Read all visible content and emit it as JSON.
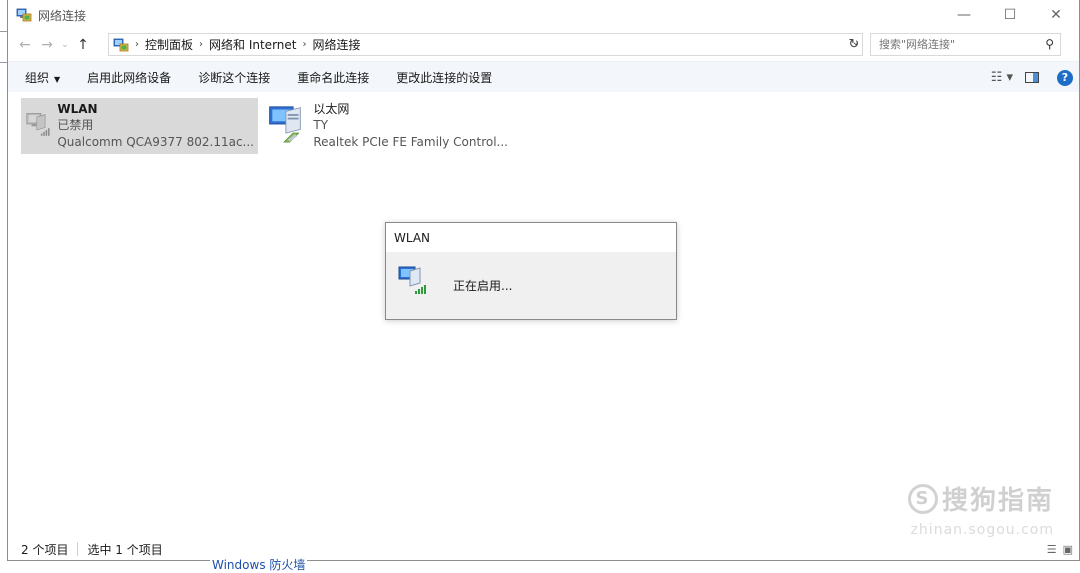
{
  "window": {
    "title": "网络连接",
    "minimize": "—",
    "maximize": "☐",
    "close": "✕"
  },
  "address": {
    "back": "←",
    "forward": "→",
    "recent": "⌄",
    "up": "↑",
    "breadcrumbs": [
      "控制面板",
      "网络和 Internet",
      "网络连接"
    ],
    "search_placeholder": "搜索\"网络连接\""
  },
  "commands": {
    "organize": "组织",
    "enable": "启用此网络设备",
    "diagnose": "诊断这个连接",
    "rename": "重命名此连接",
    "change": "更改此连接的设置",
    "help": "?"
  },
  "connections": [
    {
      "name": "WLAN",
      "status": "已禁用",
      "device": "Qualcomm QCA9377 802.11ac..."
    },
    {
      "name": "以太网",
      "status": "TY",
      "device": "Realtek PCIe FE Family Control..."
    }
  ],
  "dialog": {
    "title": "WLAN",
    "message": "正在启用..."
  },
  "statusbar": {
    "count": "2 个项目",
    "selected": "选中 1 个项目"
  },
  "background": {
    "behind_text": "Windows 防火墙"
  },
  "watermark": {
    "main": "搜狗指南",
    "sub": "zhinan.sogou.com"
  },
  "colors": {
    "accent": "#1e6ec8",
    "selection": "#d9d9d9",
    "cmdbar": "#f3f6fa"
  }
}
